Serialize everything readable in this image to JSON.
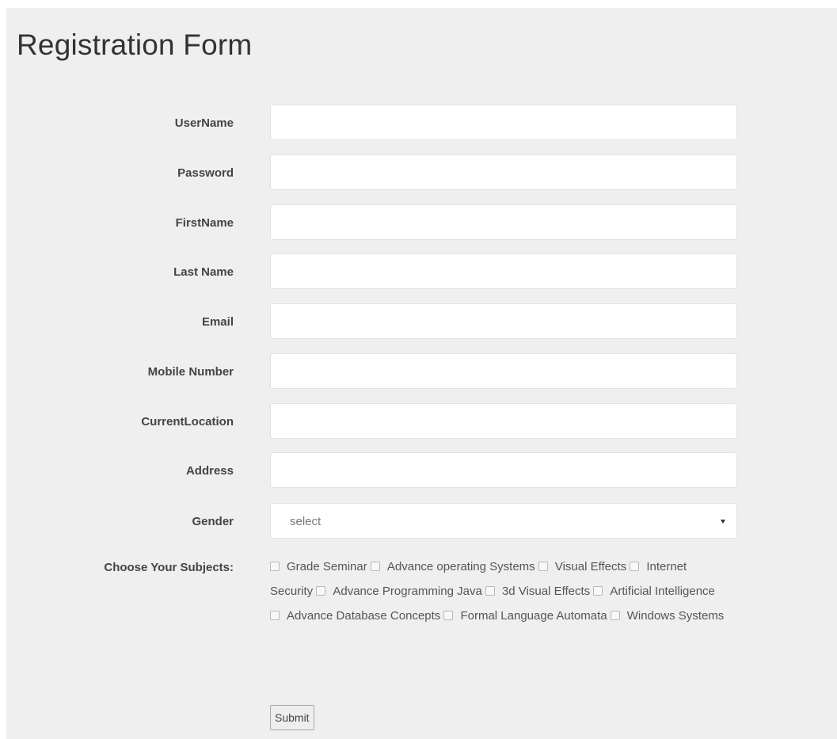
{
  "page": {
    "title": "Registration Form"
  },
  "fields": [
    {
      "label": "UserName",
      "value": "",
      "placeholder": ""
    },
    {
      "label": "Password",
      "value": "",
      "placeholder": ""
    },
    {
      "label": "FirstName",
      "value": "",
      "placeholder": ""
    },
    {
      "label": "Last Name",
      "value": "",
      "placeholder": ""
    },
    {
      "label": "Email",
      "value": "",
      "placeholder": ""
    },
    {
      "label": "Mobile Number",
      "value": "",
      "placeholder": ""
    },
    {
      "label": "CurrentLocation",
      "value": "",
      "placeholder": ""
    },
    {
      "label": "Address",
      "value": "",
      "placeholder": ""
    }
  ],
  "gender": {
    "label": "Gender",
    "selected": "select",
    "icon": "chevron-down-icon"
  },
  "subjects": {
    "label": "Choose Your Subjects:",
    "items": [
      "Grade Seminar",
      "Advance operating Systems",
      "Visual Effects",
      "Internet Security",
      "Advance Programming Java",
      "3d Visual Effects",
      "Artificial Intelligence",
      "Advance Database Concepts",
      "Formal Language Automata",
      "Windows Systems"
    ]
  },
  "submit": {
    "label": "Submit"
  },
  "colors": {
    "panel_background": "#efefef",
    "input_background": "#ffffff",
    "label_text": "#444444"
  }
}
